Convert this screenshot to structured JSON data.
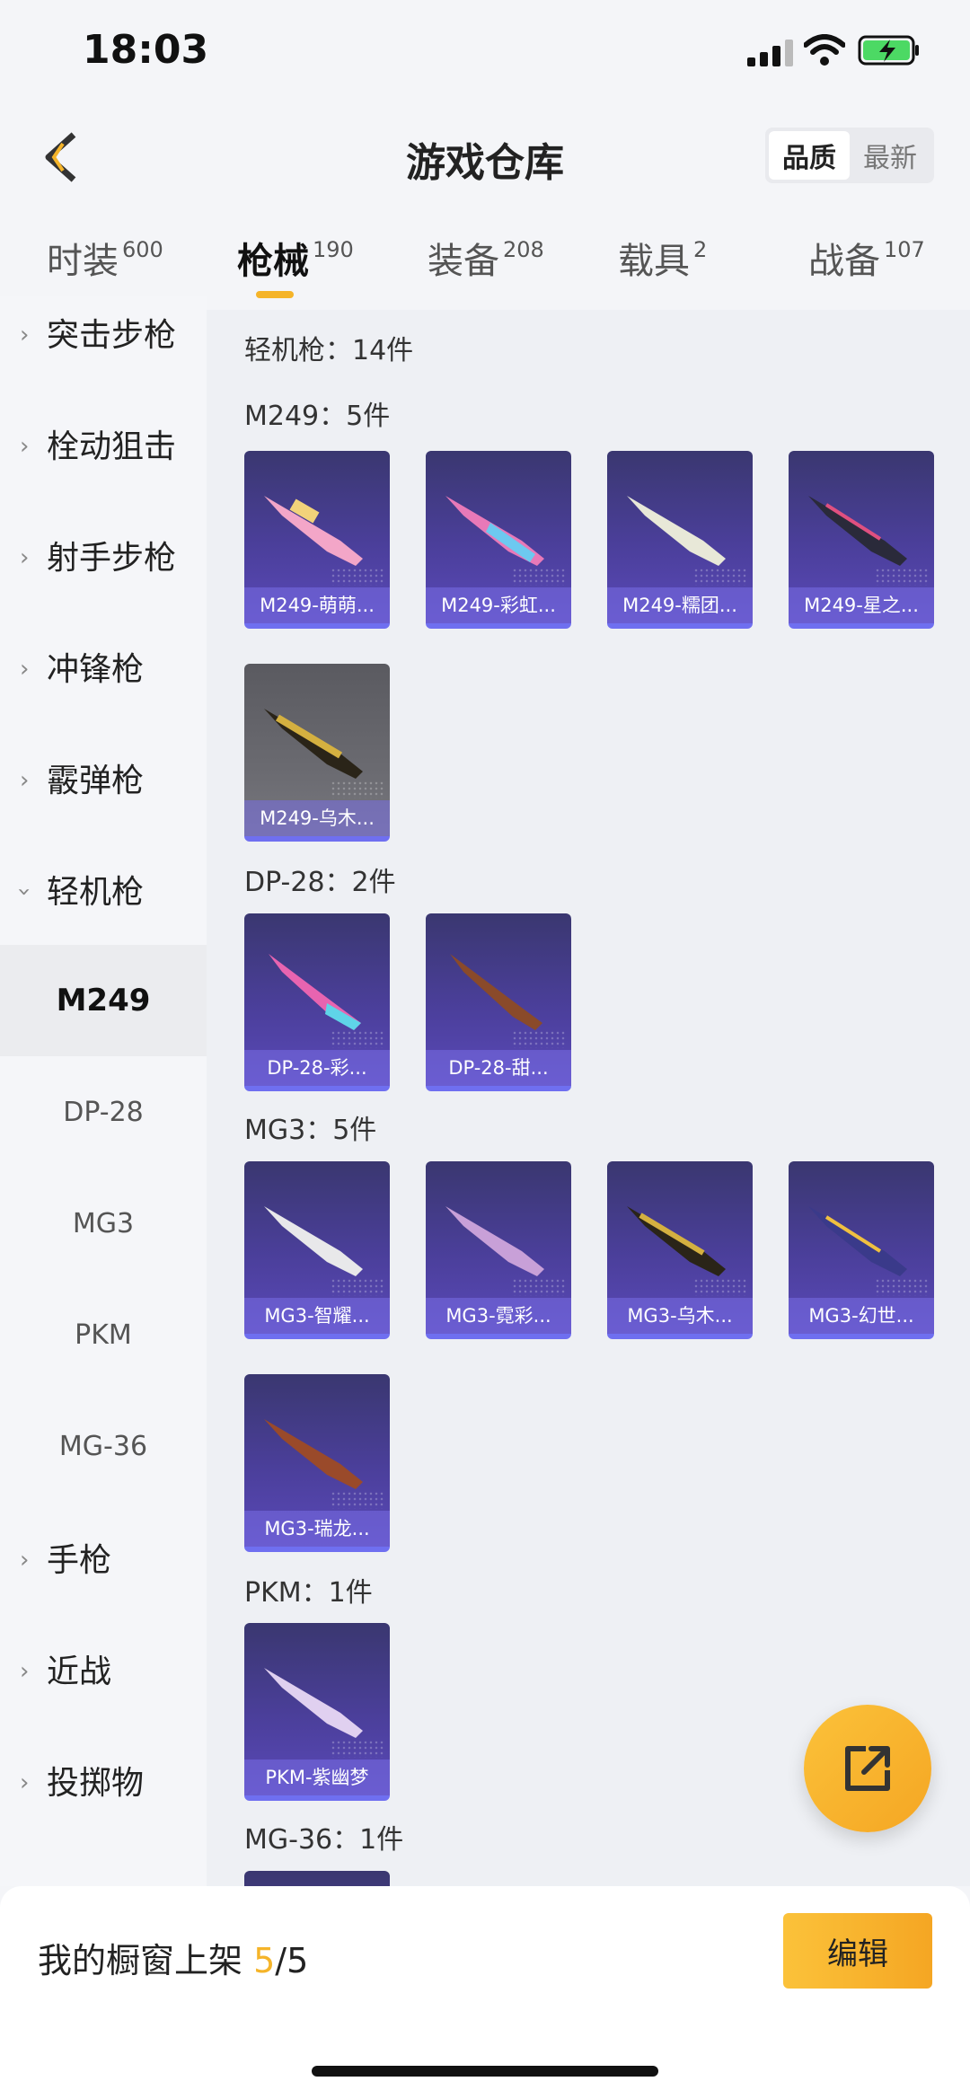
{
  "status": {
    "time": "18:03"
  },
  "header": {
    "title": "游戏仓库",
    "sort": [
      "品质",
      "最新"
    ],
    "sort_active": 0
  },
  "tabs": [
    {
      "label": "时装",
      "count": "600"
    },
    {
      "label": "枪械",
      "count": "190"
    },
    {
      "label": "装备",
      "count": "208"
    },
    {
      "label": "载具",
      "count": "2"
    },
    {
      "label": "战备",
      "count": "107"
    }
  ],
  "active_tab": 1,
  "sidebar": {
    "items": [
      {
        "label": "突击步枪",
        "type": "category",
        "expanded": false
      },
      {
        "label": "栓动狙击",
        "type": "category",
        "expanded": false
      },
      {
        "label": "射手步枪",
        "type": "category",
        "expanded": false
      },
      {
        "label": "冲锋枪",
        "type": "category",
        "expanded": false
      },
      {
        "label": "霰弹枪",
        "type": "category",
        "expanded": false
      },
      {
        "label": "轻机枪",
        "type": "category",
        "expanded": true
      },
      {
        "label": "M249",
        "type": "sub",
        "active": true
      },
      {
        "label": "DP-28",
        "type": "sub"
      },
      {
        "label": "MG3",
        "type": "sub"
      },
      {
        "label": "PKM",
        "type": "sub"
      },
      {
        "label": "MG-36",
        "type": "sub"
      },
      {
        "label": "手枪",
        "type": "category",
        "expanded": false
      },
      {
        "label": "近战",
        "type": "category",
        "expanded": false
      },
      {
        "label": "投掷物",
        "type": "category",
        "expanded": false
      }
    ]
  },
  "content": {
    "category_total": "轻机枪：14件",
    "groups": [
      {
        "label": "M249：5件",
        "items": [
          "M249-萌萌...",
          "M249-彩虹...",
          "M249-糯团...",
          "M249-星之...",
          "M249-乌木..."
        ]
      },
      {
        "label": "DP-28：2件",
        "items": [
          "DP-28-彩...",
          "DP-28-甜..."
        ]
      },
      {
        "label": "MG3：5件",
        "items": [
          "MG3-智耀...",
          "MG3-霓彩...",
          "MG3-乌木...",
          "MG3-幻世...",
          "MG3-瑞龙..."
        ]
      },
      {
        "label": "PKM：1件",
        "items": [
          "PKM-紫幽梦"
        ]
      },
      {
        "label": "MG-36：1件",
        "items": []
      }
    ]
  },
  "bottom": {
    "showcase_label": "我的橱窗上架",
    "showcase_used": "5",
    "showcase_sep": "/",
    "showcase_total": "5",
    "edit_label": "编辑"
  },
  "colors": {
    "accent": "#f5b429",
    "card_bg": "#4b3f9b",
    "card_border": "#6f6ff0"
  }
}
